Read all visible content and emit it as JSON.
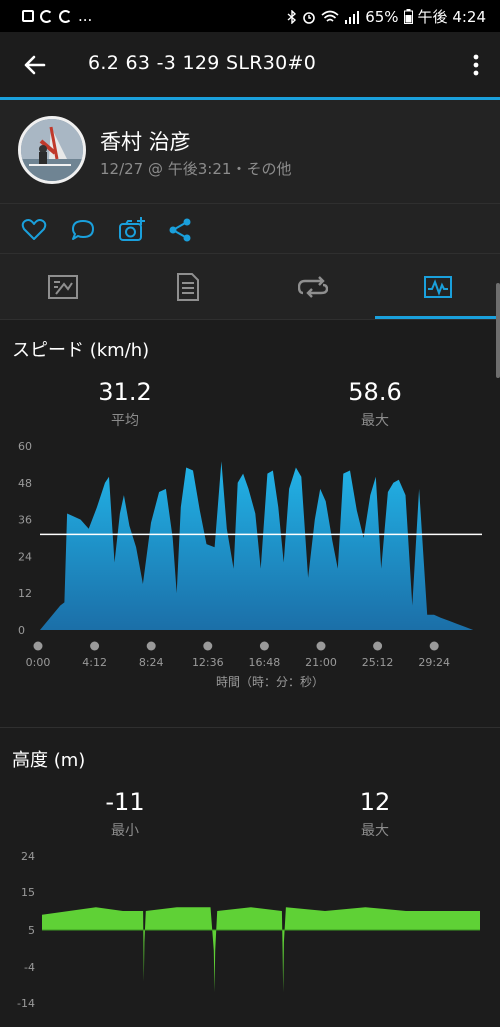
{
  "status_bar": {
    "ellipsis": "...",
    "battery": "65%",
    "time": "午後 4:24"
  },
  "app_bar": {
    "title": "6.2  63  -3  129    SLR30#0"
  },
  "activity": {
    "user_name": "香村 治彦",
    "subtitle": "12/27 @ 午後3:21・その他"
  },
  "icons": {
    "back": "arrow-back-icon",
    "more": "more-vert-icon",
    "like": "heart-icon",
    "comment": "comment-icon",
    "photo": "add-photo-icon",
    "share": "share-icon",
    "tabs": [
      "map-icon",
      "details-icon",
      "laps-icon",
      "charts-icon"
    ]
  },
  "colors": {
    "accent": "#1aa0dc",
    "speed_fill": "#1ba3d8",
    "elevation_fill": "#5fd136",
    "average_line": "#ffffff"
  },
  "speed": {
    "title": "スピード (km/h)",
    "avg_value": "31.2",
    "avg_label": "平均",
    "max_value": "58.6",
    "max_label": "最大",
    "x_axis_label": "時間（時：分：秒）"
  },
  "elevation": {
    "title": "高度 (m)",
    "min_value": "-11",
    "min_label": "最小",
    "max_value": "12",
    "max_label": "最大"
  },
  "chart_data": [
    {
      "type": "area",
      "title": "スピード (km/h)",
      "xlabel": "時間（時：分：秒）",
      "ylabel": "",
      "y_ticks": [
        "60",
        "48",
        "36",
        "24",
        "12",
        "0"
      ],
      "x_ticks": [
        "0:00",
        "4:12",
        "8:24",
        "12:36",
        "16:48",
        "21:00",
        "25:12",
        "29:24"
      ],
      "ylim": [
        0,
        60
      ],
      "xlim_minutes": [
        0,
        32.5
      ],
      "average": 31.2,
      "x_minutes": [
        0,
        1.5,
        1.8,
        2.0,
        2.5,
        3.0,
        3.6,
        4.2,
        4.8,
        5.1,
        5.5,
        5.9,
        6.2,
        6.6,
        7.1,
        7.6,
        8.2,
        8.8,
        9.3,
        9.8,
        10.1,
        10.4,
        10.8,
        11.3,
        11.8,
        12.3,
        12.9,
        13.4,
        13.8,
        14.3,
        14.6,
        15.0,
        15.4,
        15.9,
        16.3,
        16.8,
        17.2,
        17.6,
        18.0,
        18.4,
        18.9,
        19.3,
        19.8,
        20.3,
        20.7,
        21.1,
        21.6,
        22.0,
        22.4,
        22.9,
        23.4,
        23.9,
        24.4,
        24.8,
        25.2,
        25.7,
        26.1,
        26.5,
        27.0,
        27.5,
        28.0,
        28.6,
        29.1,
        29.6,
        30.2,
        30.8,
        31.4,
        32.0,
        32.5
      ],
      "values": [
        0,
        8,
        9,
        38,
        37,
        36,
        33,
        40,
        48,
        50,
        22,
        38,
        44,
        34,
        27,
        15,
        35,
        45,
        46,
        30,
        12,
        40,
        53,
        52,
        39,
        28,
        27,
        55,
        33,
        20,
        48,
        51,
        46,
        38,
        20,
        51,
        52,
        40,
        22,
        46,
        53,
        50,
        17,
        36,
        46,
        42,
        29,
        20,
        51,
        52,
        39,
        30,
        44,
        50,
        20,
        45,
        48,
        49,
        44,
        8,
        46,
        5,
        5,
        4,
        3,
        2,
        1,
        0,
        0
      ]
    },
    {
      "type": "area",
      "title": "高度 (m)",
      "y_ticks": [
        "24",
        "15",
        "5",
        "-4",
        "-14"
      ],
      "ylim": [
        -14,
        24
      ],
      "min": -11,
      "max": 12,
      "x_minutes": [
        0,
        2.0,
        4.0,
        6.0,
        7.5,
        7.55,
        7.6,
        7.7,
        10.0,
        12.5,
        12.75,
        12.8,
        12.85,
        13.0,
        15.5,
        17.8,
        17.85,
        17.9,
        17.95,
        18.1,
        21.0,
        24.0,
        27.0,
        30.0,
        32.5
      ],
      "values": [
        9,
        10,
        11,
        10,
        10,
        -8,
        2,
        10,
        11,
        11,
        0,
        -11,
        0,
        10,
        11,
        10,
        0,
        -11,
        2,
        11,
        10,
        11,
        10,
        10,
        10
      ]
    }
  ]
}
